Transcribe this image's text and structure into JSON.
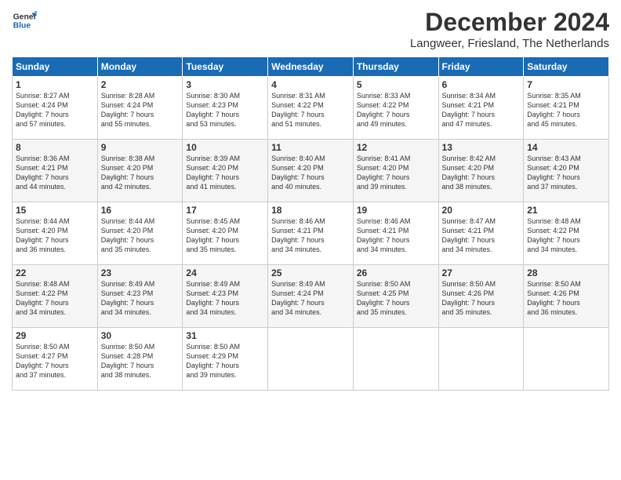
{
  "header": {
    "logo_line1": "General",
    "logo_line2": "Blue",
    "main_title": "December 2024",
    "subtitle": "Langweer, Friesland, The Netherlands"
  },
  "days_of_week": [
    "Sunday",
    "Monday",
    "Tuesday",
    "Wednesday",
    "Thursday",
    "Friday",
    "Saturday"
  ],
  "weeks": [
    [
      {
        "day": 1,
        "info": "Sunrise: 8:27 AM\nSunset: 4:24 PM\nDaylight: 7 hours\nand 57 minutes."
      },
      {
        "day": 2,
        "info": "Sunrise: 8:28 AM\nSunset: 4:24 PM\nDaylight: 7 hours\nand 55 minutes."
      },
      {
        "day": 3,
        "info": "Sunrise: 8:30 AM\nSunset: 4:23 PM\nDaylight: 7 hours\nand 53 minutes."
      },
      {
        "day": 4,
        "info": "Sunrise: 8:31 AM\nSunset: 4:22 PM\nDaylight: 7 hours\nand 51 minutes."
      },
      {
        "day": 5,
        "info": "Sunrise: 8:33 AM\nSunset: 4:22 PM\nDaylight: 7 hours\nand 49 minutes."
      },
      {
        "day": 6,
        "info": "Sunrise: 8:34 AM\nSunset: 4:21 PM\nDaylight: 7 hours\nand 47 minutes."
      },
      {
        "day": 7,
        "info": "Sunrise: 8:35 AM\nSunset: 4:21 PM\nDaylight: 7 hours\nand 45 minutes."
      }
    ],
    [
      {
        "day": 8,
        "info": "Sunrise: 8:36 AM\nSunset: 4:21 PM\nDaylight: 7 hours\nand 44 minutes."
      },
      {
        "day": 9,
        "info": "Sunrise: 8:38 AM\nSunset: 4:20 PM\nDaylight: 7 hours\nand 42 minutes."
      },
      {
        "day": 10,
        "info": "Sunrise: 8:39 AM\nSunset: 4:20 PM\nDaylight: 7 hours\nand 41 minutes."
      },
      {
        "day": 11,
        "info": "Sunrise: 8:40 AM\nSunset: 4:20 PM\nDaylight: 7 hours\nand 40 minutes."
      },
      {
        "day": 12,
        "info": "Sunrise: 8:41 AM\nSunset: 4:20 PM\nDaylight: 7 hours\nand 39 minutes."
      },
      {
        "day": 13,
        "info": "Sunrise: 8:42 AM\nSunset: 4:20 PM\nDaylight: 7 hours\nand 38 minutes."
      },
      {
        "day": 14,
        "info": "Sunrise: 8:43 AM\nSunset: 4:20 PM\nDaylight: 7 hours\nand 37 minutes."
      }
    ],
    [
      {
        "day": 15,
        "info": "Sunrise: 8:44 AM\nSunset: 4:20 PM\nDaylight: 7 hours\nand 36 minutes."
      },
      {
        "day": 16,
        "info": "Sunrise: 8:44 AM\nSunset: 4:20 PM\nDaylight: 7 hours\nand 35 minutes."
      },
      {
        "day": 17,
        "info": "Sunrise: 8:45 AM\nSunset: 4:20 PM\nDaylight: 7 hours\nand 35 minutes."
      },
      {
        "day": 18,
        "info": "Sunrise: 8:46 AM\nSunset: 4:21 PM\nDaylight: 7 hours\nand 34 minutes."
      },
      {
        "day": 19,
        "info": "Sunrise: 8:46 AM\nSunset: 4:21 PM\nDaylight: 7 hours\nand 34 minutes."
      },
      {
        "day": 20,
        "info": "Sunrise: 8:47 AM\nSunset: 4:21 PM\nDaylight: 7 hours\nand 34 minutes."
      },
      {
        "day": 21,
        "info": "Sunrise: 8:48 AM\nSunset: 4:22 PM\nDaylight: 7 hours\nand 34 minutes."
      }
    ],
    [
      {
        "day": 22,
        "info": "Sunrise: 8:48 AM\nSunset: 4:22 PM\nDaylight: 7 hours\nand 34 minutes."
      },
      {
        "day": 23,
        "info": "Sunrise: 8:49 AM\nSunset: 4:23 PM\nDaylight: 7 hours\nand 34 minutes."
      },
      {
        "day": 24,
        "info": "Sunrise: 8:49 AM\nSunset: 4:23 PM\nDaylight: 7 hours\nand 34 minutes."
      },
      {
        "day": 25,
        "info": "Sunrise: 8:49 AM\nSunset: 4:24 PM\nDaylight: 7 hours\nand 34 minutes."
      },
      {
        "day": 26,
        "info": "Sunrise: 8:50 AM\nSunset: 4:25 PM\nDaylight: 7 hours\nand 35 minutes."
      },
      {
        "day": 27,
        "info": "Sunrise: 8:50 AM\nSunset: 4:26 PM\nDaylight: 7 hours\nand 35 minutes."
      },
      {
        "day": 28,
        "info": "Sunrise: 8:50 AM\nSunset: 4:26 PM\nDaylight: 7 hours\nand 36 minutes."
      }
    ],
    [
      {
        "day": 29,
        "info": "Sunrise: 8:50 AM\nSunset: 4:27 PM\nDaylight: 7 hours\nand 37 minutes."
      },
      {
        "day": 30,
        "info": "Sunrise: 8:50 AM\nSunset: 4:28 PM\nDaylight: 7 hours\nand 38 minutes."
      },
      {
        "day": 31,
        "info": "Sunrise: 8:50 AM\nSunset: 4:29 PM\nDaylight: 7 hours\nand 39 minutes."
      },
      null,
      null,
      null,
      null
    ]
  ]
}
